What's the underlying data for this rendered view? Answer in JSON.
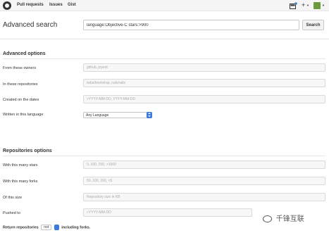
{
  "header": {
    "nav": [
      "Pull requests",
      "Issues",
      "Gist"
    ],
    "icons": [
      "octocat-icon",
      "notification-icon",
      "plus-icon",
      "avatar"
    ]
  },
  "search": {
    "title": "Advanced search",
    "query": "language:Objective-C stars:>900",
    "button_label": "Search"
  },
  "advanced_options": {
    "title": "Advanced options",
    "rows": [
      {
        "label": "From these owners",
        "placeholder": "github, joyent"
      },
      {
        "label": "In these repositories",
        "placeholder": "twbs/bootstrap, rails/rails"
      },
      {
        "label": "Created on the dates",
        "placeholder": ">YYYY-MM-DD, YYYY-MM-DD"
      }
    ],
    "language_label": "Written in this language",
    "language_value": "Any Language"
  },
  "repository_options": {
    "title": "Repositories options",
    "rows": [
      {
        "label": "With this many stars",
        "placeholder": "0..100, 200, >1000"
      },
      {
        "label": "With this many forks",
        "placeholder": "50..100, 200, <5"
      },
      {
        "label": "Of this size",
        "placeholder": "Repository size in KB"
      },
      {
        "label": "Pushed to",
        "placeholder": "<YYYY-MM-DD"
      }
    ],
    "return_prefix": "Return repositories",
    "return_value": "not",
    "return_suffix": "including forks."
  },
  "watermark": "千锋互联",
  "colors": {
    "accent": "#3b7be0",
    "header_bg": "#f5f5f5"
  }
}
